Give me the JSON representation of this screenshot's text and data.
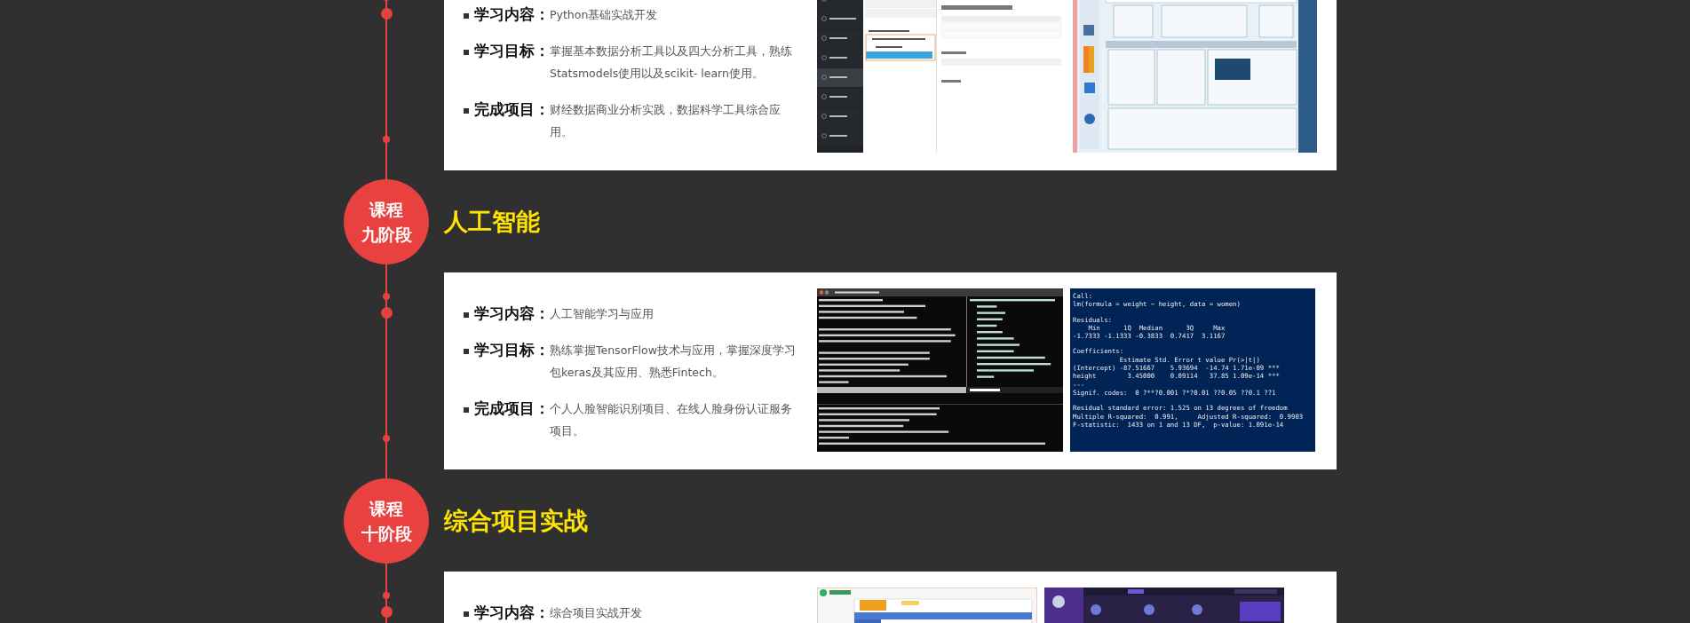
{
  "timeline": [
    {
      "kind": "card",
      "items": [
        {
          "label": "学习内容：",
          "text": "Python基础实战开发"
        },
        {
          "label": "学习目标：",
          "text": "掌握基本数据分析工具以及四大分析工具，熟练Statsmodels使用以及scikit- learn使用。"
        },
        {
          "label": "完成项目：",
          "text": "财经数据商业分析实践，数据科学工具综合应用。"
        }
      ],
      "screenshots": [
        {
          "kind": "admin"
        },
        {
          "kind": "diagram"
        }
      ]
    },
    {
      "kind": "stage",
      "badge": [
        "课程",
        "九阶段"
      ],
      "title": "人工智能"
    },
    {
      "kind": "card",
      "items": [
        {
          "label": "学习内容：",
          "text": "人工智能学习与应用"
        },
        {
          "label": "学习目标：",
          "text": "熟练掌握TensorFlow技术与应用，掌握深度学习包keras及其应用、熟悉Fintech。"
        },
        {
          "label": "完成项目：",
          "text": "个人人脸智能识别项目、在线人脸身份认证服务项目。"
        }
      ],
      "screenshots": [
        {
          "kind": "vim"
        },
        {
          "kind": "console",
          "blocks": [
            [
              "Call:",
              "lm(formula = weight ~ height, data = women)"
            ],
            [
              "Residuals:",
              "    Min      1Q  Median      3Q     Max",
              "-1.7333 -1.1333 -0.3833  0.7417  3.1167"
            ],
            [
              "Coefficients:",
              "            Estimate Std. Error t value Pr(>|t|)",
              "(Intercept) -87.51667    5.93694  -14.74 1.71e-09 ***",
              "height        3.45000    0.09114   37.85 1.09e-14 ***",
              "---",
              "Signif. codes:  0 ?**?0.001 ?*?0.01 ??0.05 ??0.1 ??1"
            ],
            [
              "Residual standard error: 1.525 on 13 degrees of freedom",
              "Multiple R-squared:  0.991,     Adjusted R-squared:  0.9903",
              "F-statistic:  1433 on 1 and 13 DF,  p-value: 1.091e-14"
            ]
          ]
        }
      ]
    },
    {
      "kind": "stage",
      "badge": [
        "课程",
        "十阶段"
      ],
      "title": "综合项目实战"
    },
    {
      "kind": "card",
      "items": [
        {
          "label": "学习内容：",
          "text": "综合项目实战开发"
        }
      ],
      "screenshots": [
        {
          "kind": "website"
        },
        {
          "kind": "dashboard"
        }
      ]
    }
  ]
}
